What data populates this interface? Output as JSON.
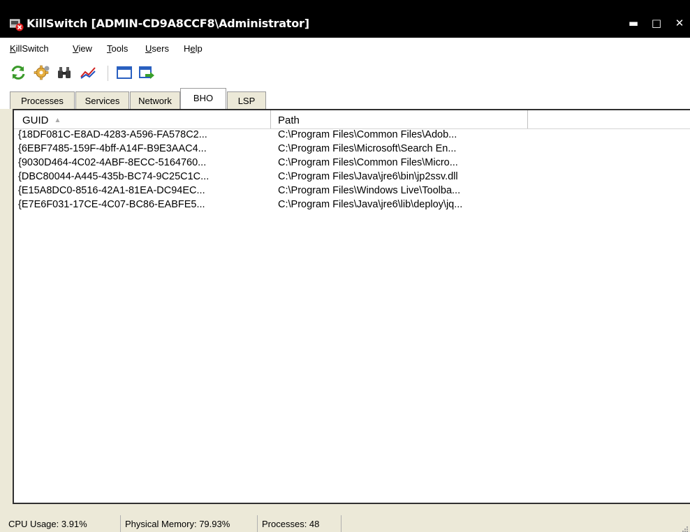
{
  "window": {
    "title": "KillSwitch [ADMIN-CD9A8CCF8\\Administrator]",
    "controls": {
      "minimize": "▬",
      "maximize": "□",
      "close": "✕"
    }
  },
  "menubar": {
    "items": [
      "KillSwitch",
      "View",
      "Tools",
      "Users",
      "Help"
    ],
    "mnemonics": [
      "K",
      "V",
      "T",
      "U",
      "e"
    ]
  },
  "toolbar": {
    "icons": [
      "refresh-icon",
      "settings-gear-icon",
      "binoculars-icon",
      "graph-icon",
      "window-icon",
      "export-icon"
    ]
  },
  "tabs": {
    "items": [
      "Processes",
      "Services",
      "Network",
      "BHO",
      "LSP"
    ],
    "active": "BHO"
  },
  "listview": {
    "columns": [
      "GUID",
      "Path"
    ],
    "sort_column": "GUID",
    "sort_direction": "ascending",
    "rows": [
      {
        "guid": "{18DF081C-E8AD-4283-A596-FA578C2...",
        "path": "C:\\Program Files\\Common Files\\Adob..."
      },
      {
        "guid": "{6EBF7485-159F-4bff-A14F-B9E3AAC4...",
        "path": "C:\\Program Files\\Microsoft\\Search En..."
      },
      {
        "guid": "{9030D464-4C02-4ABF-8ECC-5164760...",
        "path": "C:\\Program Files\\Common Files\\Micro..."
      },
      {
        "guid": "{DBC80044-A445-435b-BC74-9C25C1C...",
        "path": "C:\\Program Files\\Java\\jre6\\bin\\jp2ssv.dll"
      },
      {
        "guid": "{E15A8DC0-8516-42A1-81EA-DC94EC...",
        "path": "C:\\Program Files\\Windows Live\\Toolba..."
      },
      {
        "guid": "{E7E6F031-17CE-4C07-BC86-EABFE5...",
        "path": "C:\\Program Files\\Java\\jre6\\lib\\deploy\\jq..."
      }
    ]
  },
  "statusbar": {
    "cpu": "CPU Usage: 3.91%",
    "memory": "Physical Memory: 79.93%",
    "processes": "Processes: 48"
  },
  "colors": {
    "titlebar": "#000000",
    "window_bg": "#ece9d8",
    "content_bg": "#ffffff",
    "list_border": "#303030",
    "icon_red": "#e02020"
  }
}
